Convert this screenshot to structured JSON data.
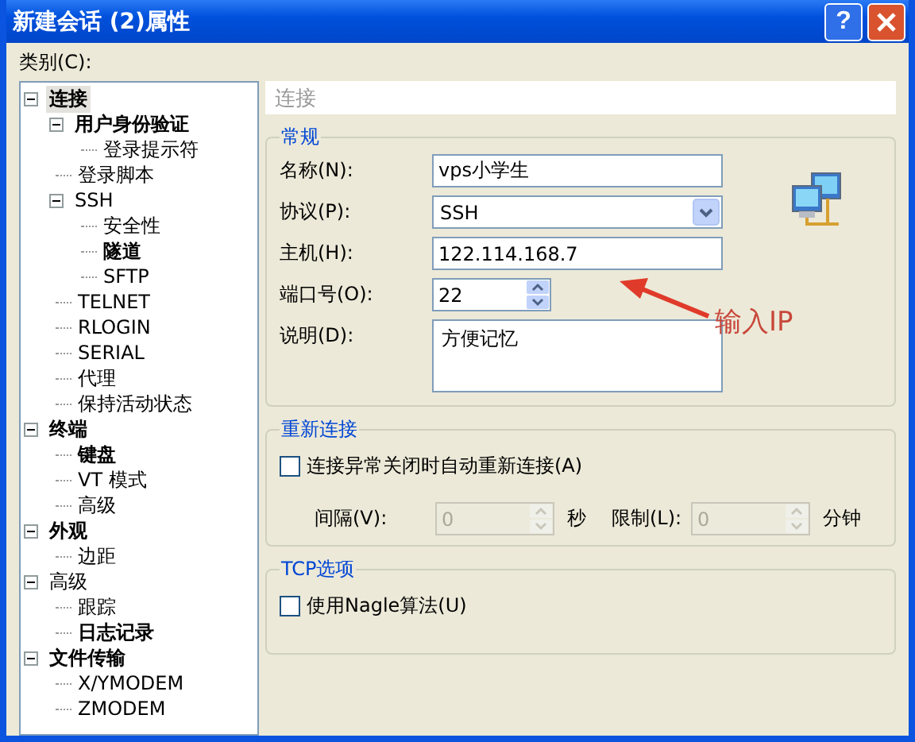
{
  "window": {
    "title": "新建会话 (2)属性",
    "help": "?"
  },
  "category_label": "类别(C):",
  "tree": [
    {
      "label": "连接",
      "bold": true,
      "selected": true,
      "expanded": true,
      "children": [
        {
          "label": "用户身份验证",
          "bold": true,
          "selected": false,
          "expanded": true,
          "children": [
            {
              "label": "登录提示符",
              "bold": false,
              "selected": false
            }
          ]
        },
        {
          "label": "登录脚本",
          "bold": false,
          "selected": false
        },
        {
          "label": "SSH",
          "bold": false,
          "selected": false,
          "expanded": true,
          "children": [
            {
              "label": "安全性",
              "bold": false,
              "selected": false
            },
            {
              "label": "隧道",
              "bold": true,
              "selected": false
            },
            {
              "label": "SFTP",
              "bold": false,
              "selected": false
            }
          ]
        },
        {
          "label": "TELNET",
          "bold": false,
          "selected": false
        },
        {
          "label": "RLOGIN",
          "bold": false,
          "selected": false
        },
        {
          "label": "SERIAL",
          "bold": false,
          "selected": false
        },
        {
          "label": "代理",
          "bold": false,
          "selected": false
        },
        {
          "label": "保持活动状态",
          "bold": false,
          "selected": false
        }
      ]
    },
    {
      "label": "终端",
      "bold": true,
      "selected": false,
      "expanded": true,
      "children": [
        {
          "label": "键盘",
          "bold": true,
          "selected": false
        },
        {
          "label": "VT 模式",
          "bold": false,
          "selected": false
        },
        {
          "label": "高级",
          "bold": false,
          "selected": false
        }
      ]
    },
    {
      "label": "外观",
      "bold": true,
      "selected": false,
      "expanded": true,
      "children": [
        {
          "label": "边距",
          "bold": false,
          "selected": false
        }
      ]
    },
    {
      "label": "高级",
      "bold": false,
      "selected": false,
      "expanded": true,
      "children": [
        {
          "label": "跟踪",
          "bold": false,
          "selected": false
        },
        {
          "label": "日志记录",
          "bold": true,
          "selected": false
        }
      ]
    },
    {
      "label": "文件传输",
      "bold": true,
      "selected": false,
      "expanded": true,
      "children": [
        {
          "label": "X/YMODEM",
          "bold": false,
          "selected": false
        },
        {
          "label": "ZMODEM",
          "bold": false,
          "selected": false
        }
      ]
    }
  ],
  "panel_title": "连接",
  "general": {
    "title": "常规",
    "fields": [
      {
        "kind": "text",
        "label": "名称(N):",
        "value": "vps小学生"
      },
      {
        "kind": "select",
        "label": "协议(P):",
        "value": "SSH"
      },
      {
        "kind": "text",
        "label": "主机(H):",
        "value": "122.114.168.7"
      },
      {
        "kind": "spin",
        "label": "端口号(O):",
        "value": "22"
      },
      {
        "kind": "area",
        "label": "说明(D):",
        "value": "方便记忆"
      }
    ]
  },
  "annotation": "输入IP",
  "reconnect": {
    "title": "重新连接",
    "checkbox": {
      "label": "连接异常关闭时自动重新连接(A)",
      "checked": false
    },
    "interval": {
      "label": "间隔(V):",
      "value": "0",
      "unit": "秒",
      "disabled": true
    },
    "limit": {
      "label": "限制(L):",
      "value": "0",
      "unit": "分钟",
      "disabled": true
    }
  },
  "tcp": {
    "title": "TCP选项",
    "checkbox": {
      "label": "使用Nagle算法(U)",
      "checked": false
    }
  }
}
